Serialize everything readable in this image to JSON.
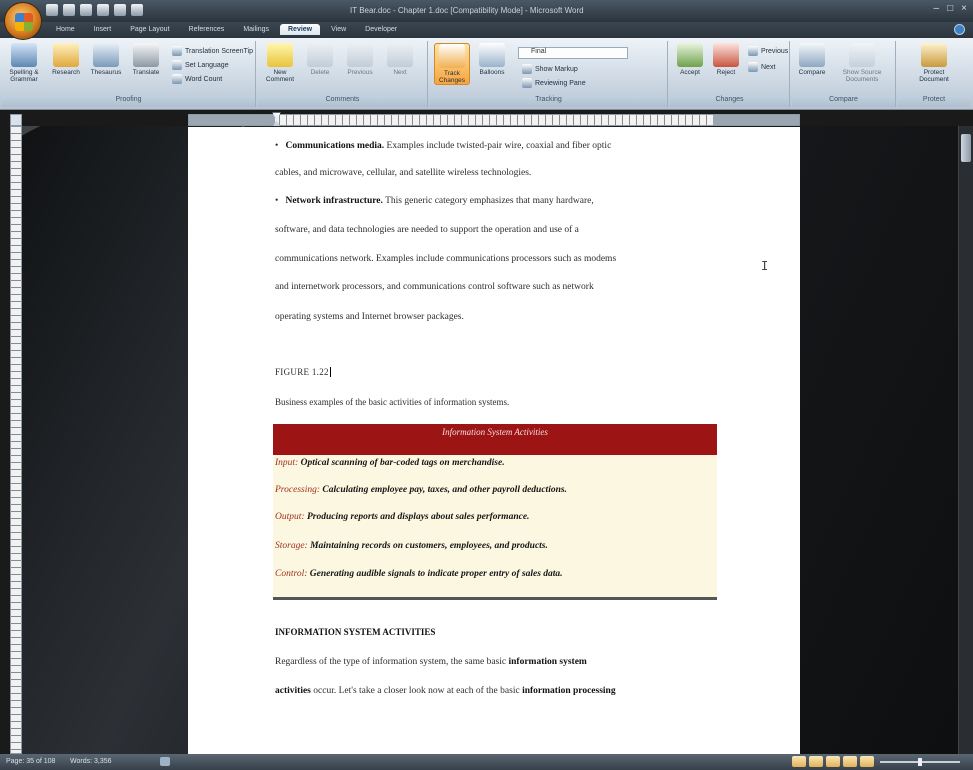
{
  "window": {
    "title": "IT Bear.doc - Chapter 1.doc [Compatibility Mode] - Microsoft Word",
    "controls": [
      "–",
      "□",
      "×"
    ]
  },
  "tabs": [
    {
      "label": "Home",
      "active": false
    },
    {
      "label": "Insert",
      "active": false
    },
    {
      "label": "Page Layout",
      "active": false
    },
    {
      "label": "References",
      "active": false
    },
    {
      "label": "Mailings",
      "active": false
    },
    {
      "label": "Review",
      "active": true
    },
    {
      "label": "View",
      "active": false
    },
    {
      "label": "Developer",
      "active": false
    }
  ],
  "ribbon": {
    "proofing": {
      "name": "Proofing",
      "spelling": "Spelling & Grammar",
      "research": "Research",
      "thesaurus": "Thesaurus",
      "translate": "Translate",
      "translation_screentip": "Translation ScreenTip",
      "set_language": "Set Language",
      "word_count": "Word Count"
    },
    "comments": {
      "name": "Comments",
      "new": "New Comment",
      "delete": "Delete",
      "previous": "Previous",
      "next": "Next"
    },
    "tracking": {
      "name": "Tracking",
      "track_changes": "Track Changes",
      "balloons": "Balloons",
      "display_for_review": "Final",
      "show_markup": "Show Markup",
      "reviewing_pane": "Reviewing Pane"
    },
    "changes": {
      "name": "Changes",
      "accept": "Accept",
      "reject": "Reject",
      "previous": "Previous",
      "next": "Next"
    },
    "compare": {
      "name": "Compare",
      "compare": "Compare",
      "show_source": "Show Source Documents"
    },
    "protect": {
      "name": "Protect",
      "protect_document": "Protect Document"
    }
  },
  "document": {
    "lines": [
      {
        "bullet": "•",
        "bold": "Communications media.",
        "rest": " Examples include twisted-pair wire, coaxial and fiber optic"
      },
      {
        "bullet": "",
        "bold": "",
        "rest": "cables, and microwave, cellular, and satellite wireless technologies."
      },
      {
        "bullet": "•",
        "bold": "Network infrastructure.",
        "rest": " This generic category emphasizes that many hardware,"
      },
      {
        "bullet": "",
        "bold": "",
        "rest": "software, and data technologies are needed to support the operation and use of a"
      },
      {
        "bullet": "",
        "bold": "",
        "rest": "communications network. Examples include communications processors such as modems"
      },
      {
        "bullet": "",
        "bold": "",
        "rest": "and internetwork processors, and communications control software such as network"
      },
      {
        "bullet": "",
        "bold": "",
        "rest": "operating systems and Internet browser packages."
      }
    ],
    "figure_label": "FIGURE 1.22",
    "figure_caption": "Business examples of the basic activities of information systems.",
    "table": {
      "header": "Information System Activities",
      "rows": [
        {
          "label": "Input:",
          "text": "Optical scanning of bar-coded tags on merchandise."
        },
        {
          "label": "Processing:",
          "text": "Calculating employee pay, taxes, and other payroll deductions."
        },
        {
          "label": "Output:",
          "text": "Producing reports and displays about sales performance."
        },
        {
          "label": "Storage:",
          "text": "Maintaining records on customers, employees, and products."
        },
        {
          "label": "Control:",
          "text": "Generating audible signals to indicate proper entry of sales data."
        }
      ]
    },
    "section_heading": "INFORMATION SYSTEM ACTIVITIES",
    "closing": [
      {
        "normal": "Regardless of the type of information system, the same basic ",
        "bold": "information system",
        "after": ""
      },
      {
        "normal": "",
        "bold": "activities",
        "after": " occur. Let's take a closer look now at each of the basic "
      },
      {
        "normal": "",
        "bold": "information processing",
        "after": ""
      }
    ]
  },
  "status_bar": {
    "page": "Page: 35 of 108",
    "words": "Words: 3,356"
  }
}
